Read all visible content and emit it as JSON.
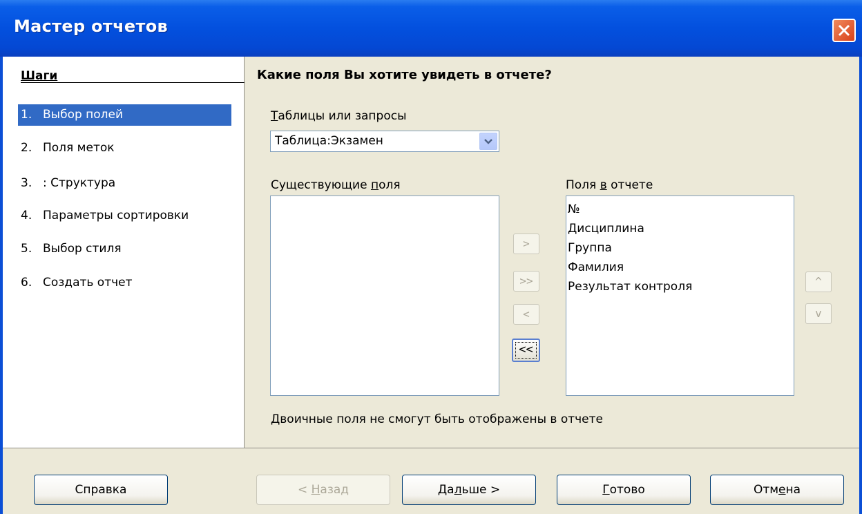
{
  "window": {
    "title": "Мастер отчетов"
  },
  "steps": {
    "title": "Шаги",
    "items": [
      {
        "num": "1.",
        "label": "Выбор полей"
      },
      {
        "num": "2.",
        "label": "Поля меток"
      },
      {
        "num": "3.",
        "label": ": Структура"
      },
      {
        "num": "4.",
        "label": "Параметры сортировки"
      },
      {
        "num": "5.",
        "label": "Выбор стиля"
      },
      {
        "num": "6.",
        "label": "Создать отчет"
      }
    ]
  },
  "main": {
    "question": "Какие поля Вы хотите увидеть в отчете?",
    "tables_label_u": "Т",
    "tables_label_rest": "аблицы или запросы",
    "table_selected": "Таблица:Экзамен",
    "existing_label_pre": "Существующие ",
    "existing_label_u": "п",
    "existing_label_post": "оля",
    "report_label_pre": "Поля ",
    "report_label_u": "в",
    "report_label_post": " отчете",
    "existing_fields": [],
    "report_fields": [
      "№",
      "Дисциплина",
      "Группа",
      "Фамилия",
      "Результат контроля"
    ],
    "move_buttons": {
      "add": ">",
      "add_all": ">>",
      "remove": "<",
      "remove_all": "<<"
    },
    "order_buttons": {
      "up": "^",
      "down": "v"
    },
    "binary_note": "Двоичные поля не смогут быть отображены в отчете"
  },
  "buttons": {
    "help": "Справка",
    "back_pre": "< ",
    "back_u": "Н",
    "back_post": "азад",
    "next_pre": "Да",
    "next_u": "л",
    "next_post": "ьше >",
    "finish_u": "Г",
    "finish_post": "отово",
    "cancel_pre": "Отм",
    "cancel_u": "е",
    "cancel_post": "на"
  }
}
